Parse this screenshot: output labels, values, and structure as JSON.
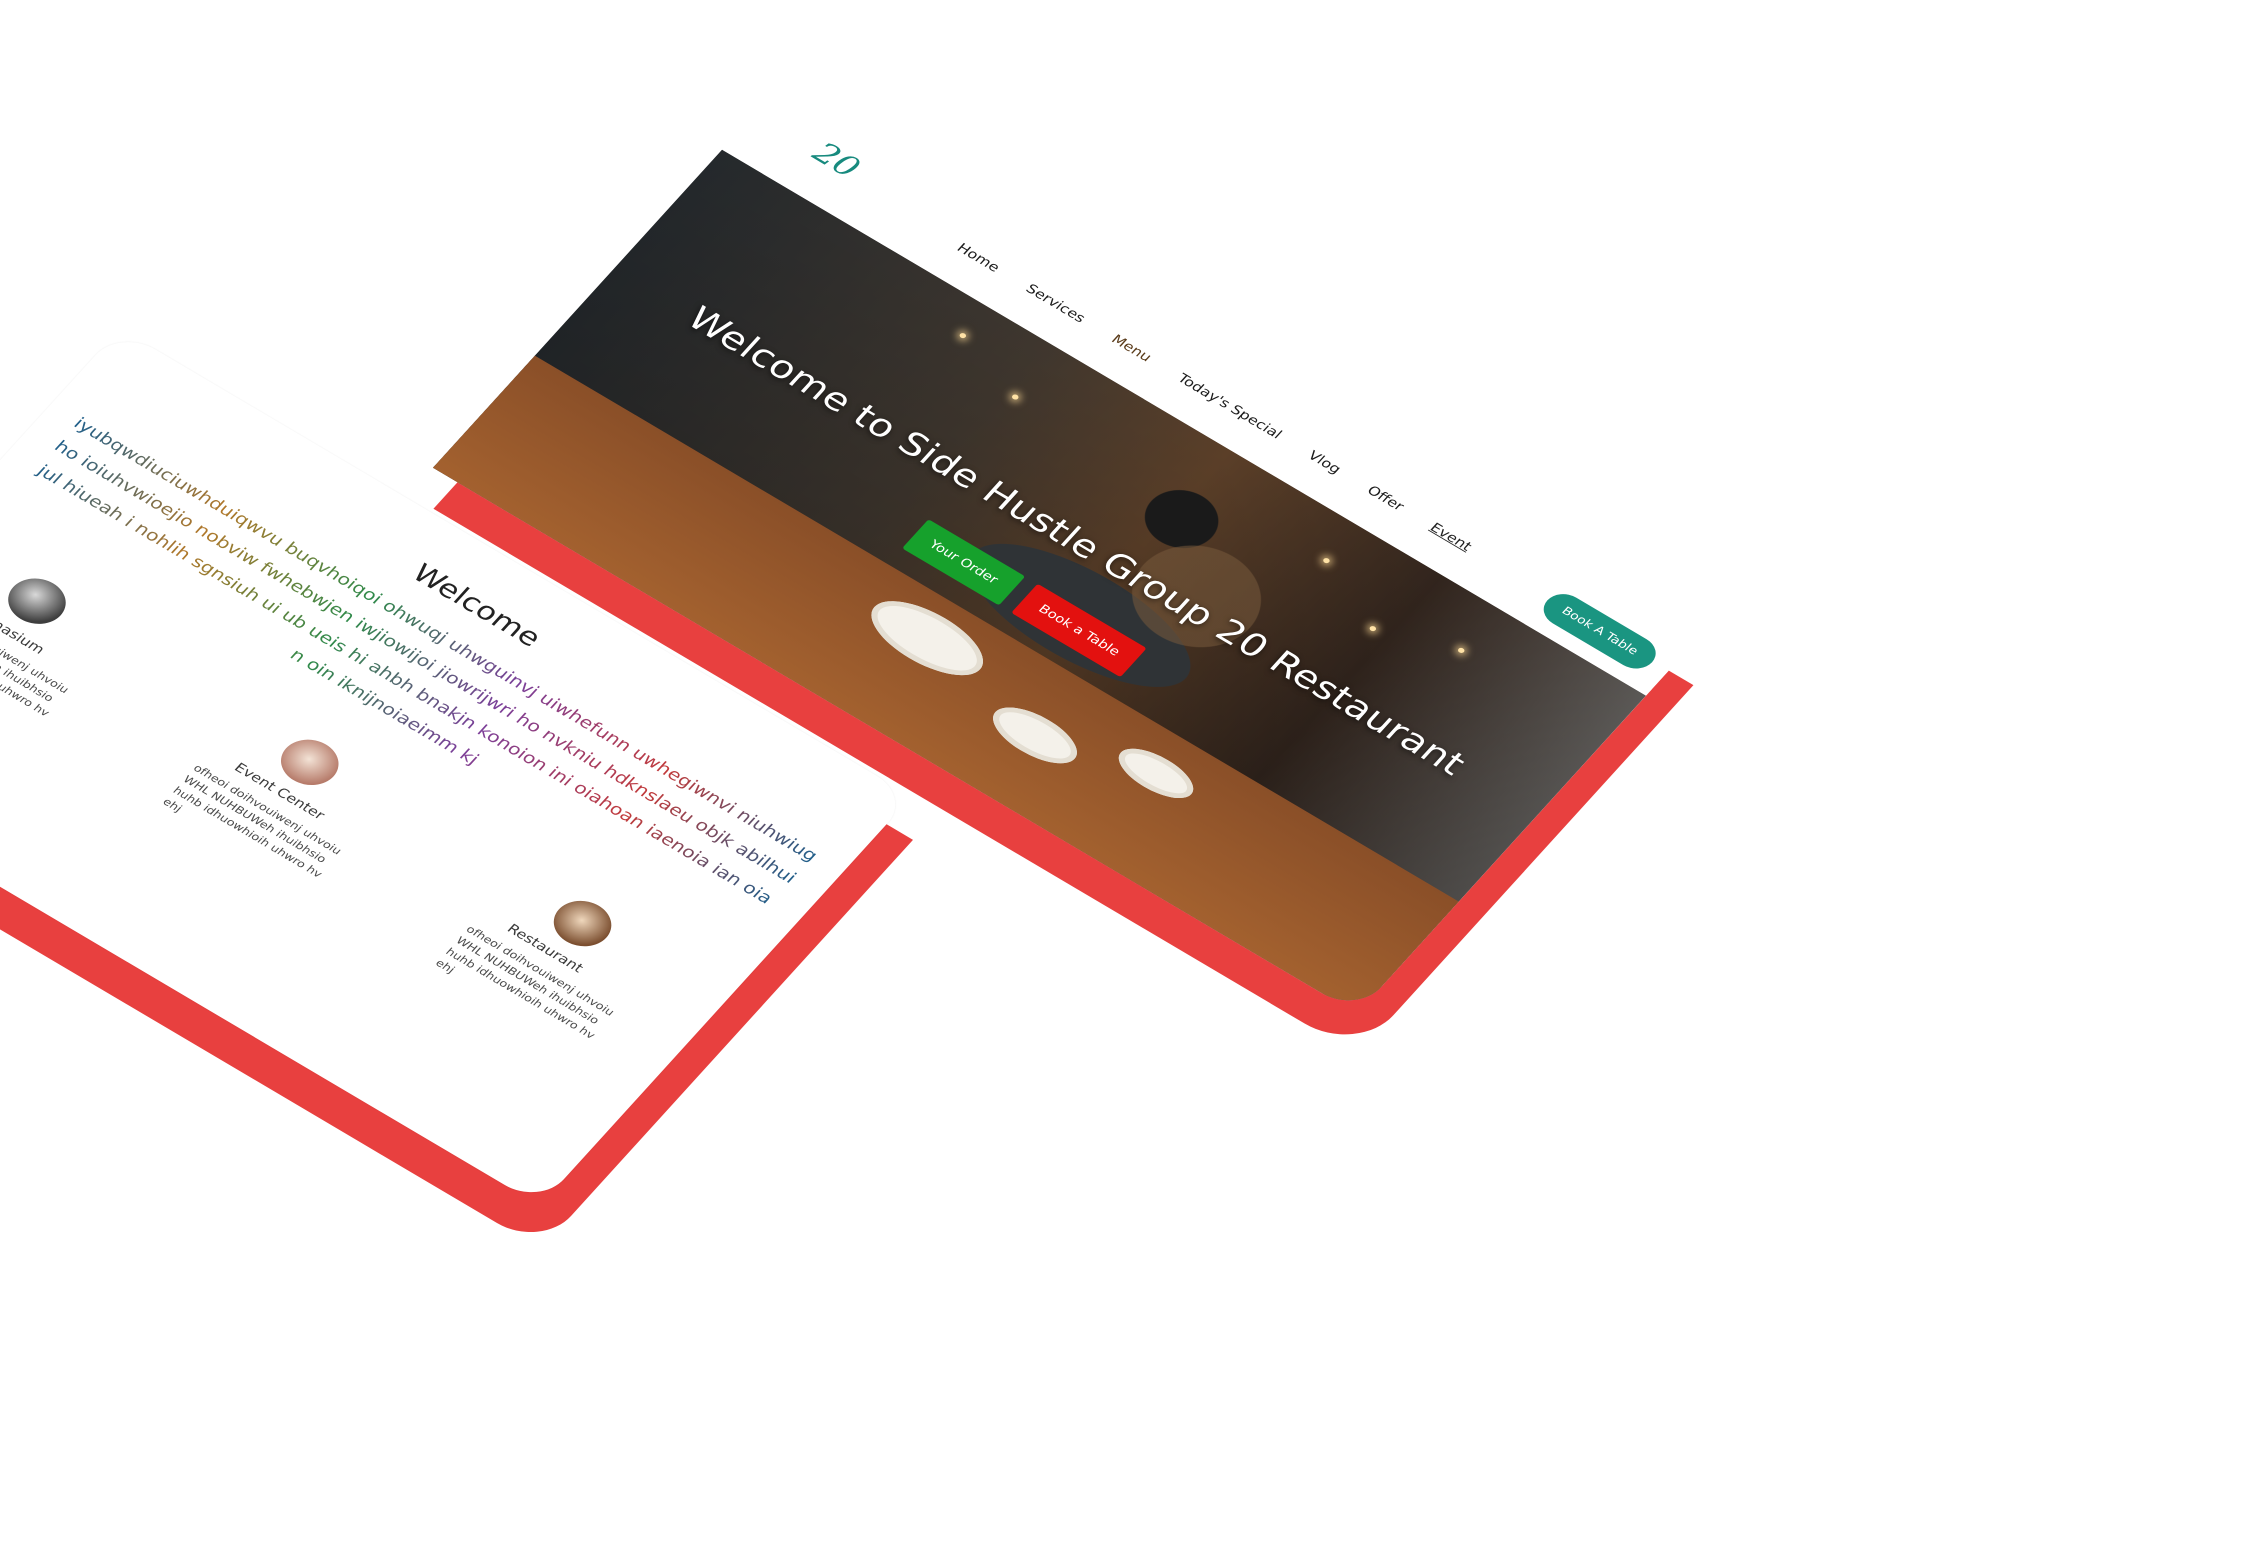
{
  "hero": {
    "logo": "20",
    "nav": [
      "Home",
      "Services",
      "Menu",
      "Today's Special",
      "Vlog",
      "Offer",
      "Event"
    ],
    "book_table_btn": "Book A Table",
    "title": "Welcome to Side Hustle Group 20 Restaurant",
    "your_order_btn": "Your Order",
    "book_btn": "Book a Table"
  },
  "content": {
    "heading": "Welcome",
    "body": "iyubqwdiuciuwhduiqwvu buqvhoiqoi ohwuqj uhwguinvj uiwhefunn uwhegiwnvi niuhwiugho ioiuhvwioejio nobviw fwhebwjen iwjiowijoi jiowrijwri ho nvkniu hdknslaeu objk abilhuijul hiueah i nohlih sgnsiuh ui ub ueis hi ahbh bnakjn konoion ini oiahoan iaenoia ian oian oin iknijnoiaeimm kj",
    "services": [
      {
        "title": "Gymnasium",
        "desc": "ofheoi doihvouiwenj uhvoiuWHL NUHBUWeh ihuibhsio huhb idhuowhioih uhwro hvehj"
      },
      {
        "title": "Event Center",
        "desc": "ofheoi doihvouiwenj uhvoiuWHL NUHBUWeh ihuibhsio huhb idhuowhioih uhwro hvehj"
      },
      {
        "title": "Restaurant",
        "desc": "ofheoi doihvouiwenj uhvoiuWHL NUHBUWeh ihuibhsio huhb idhuowhioih uhwro hvehj"
      }
    ]
  },
  "colors": {
    "slab": "#e8403f",
    "accent_teal": "#1a9581",
    "order_green": "#16a12c",
    "book_red": "#e3110f"
  }
}
